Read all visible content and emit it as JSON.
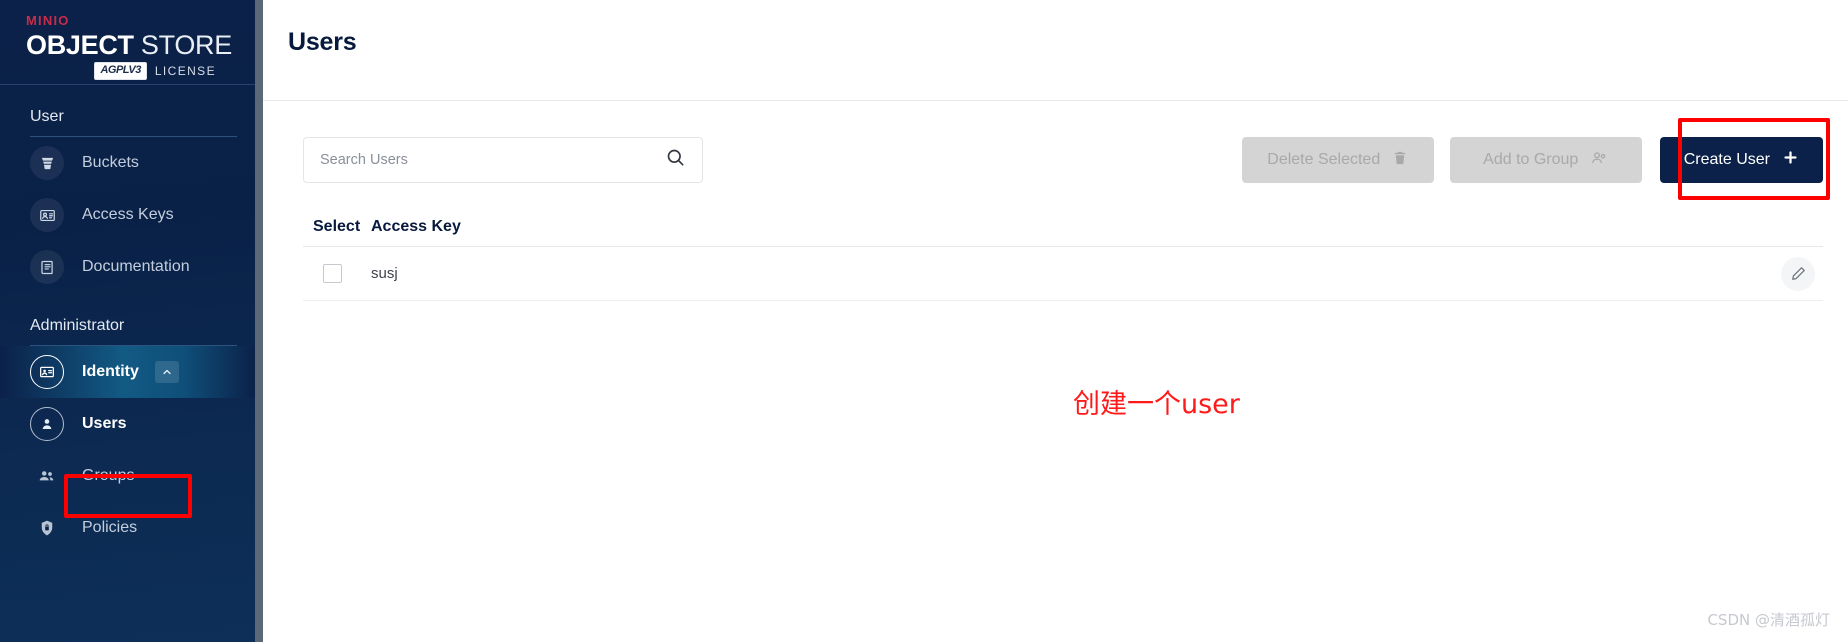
{
  "brand": {
    "minio_m": "MIN",
    "minio_io": "IO",
    "object": "OBJECT",
    "store": " STORE",
    "agpl_badge": "AGPLV3",
    "license_label": "LICENSE"
  },
  "sidebar": {
    "sections": [
      {
        "label": "User",
        "items": [
          {
            "label": "Buckets",
            "icon": "bucket-icon"
          },
          {
            "label": "Access Keys",
            "icon": "id-card-icon"
          },
          {
            "label": "Documentation",
            "icon": "book-icon"
          }
        ]
      },
      {
        "label": "Administrator",
        "items": [
          {
            "label": "Identity",
            "icon": "identity-icon",
            "expanded": true,
            "chevron": "chevron-up-icon"
          },
          {
            "label": "Users",
            "icon": "user-icon",
            "sub": true
          },
          {
            "label": "Groups",
            "icon": "groups-icon",
            "sub": true
          },
          {
            "label": "Policies",
            "icon": "shield-lock-icon",
            "sub": true
          }
        ]
      }
    ]
  },
  "header": {
    "title": "Users"
  },
  "search": {
    "value": "",
    "placeholder": "Search Users",
    "icon": "search-icon"
  },
  "toolbar": {
    "delete_selected_label": "Delete Selected",
    "delete_selected_icon": "trash-icon",
    "add_to_group_label": "Add to Group",
    "add_to_group_icon": "group-add-icon",
    "create_user_label": "Create User",
    "create_user_icon": "plus-icon"
  },
  "table": {
    "columns": [
      "Select",
      "Access Key"
    ],
    "rows": [
      {
        "selected": false,
        "access_key": "susj",
        "action_icon": "pencil-icon"
      }
    ]
  },
  "annotations": {
    "note_text": "创建一个user",
    "box_color": "#fe0000"
  },
  "watermark": {
    "text": "CSDN @清酒孤灯"
  },
  "colors": {
    "sidebar_bg": "#0b2149",
    "accent_highlight": "#125a84",
    "primary_button": "#0b2149",
    "annotation_red": "#fe0000"
  }
}
